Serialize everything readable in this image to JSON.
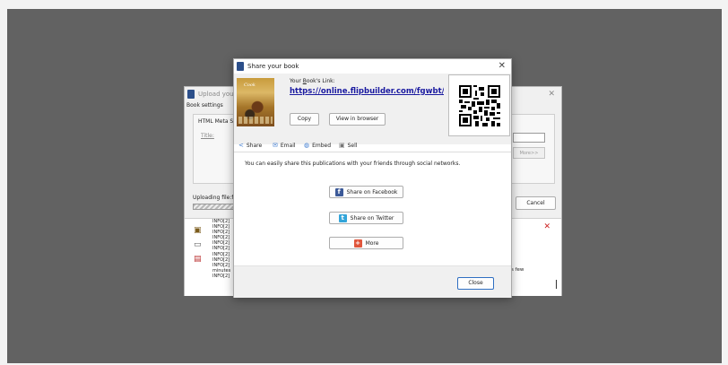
{
  "background_window": {
    "title": "Upload your",
    "tab_label": "Book settings",
    "group_legend": "HTML Meta Se",
    "title_field_label": "Title:",
    "more_label": "More>>",
    "uploading_label": "Uploading file:fli",
    "cancel_label": "Cancel",
    "log_lines": [
      "INFO[2]",
      "INFO[2]",
      "INFO[2]",
      "INFO[2]",
      "INFO[2]",
      "INFO[2]",
      "INFO[2]",
      "INFO[2]",
      "INFO[2]",
      "minutes",
      "INFO[2]"
    ],
    "log_tail": "s few"
  },
  "dialog": {
    "title": "Share your book",
    "link_label_prefix": "Your ",
    "link_label_underlined": "B",
    "link_label_suffix": "ook's Link:",
    "book_link": "https://online.flipbuilder.com/fgwbt/ceyu",
    "cover_title": "Cook",
    "copy_label": "Copy",
    "view_label": "View in browser",
    "tabs": {
      "share": "Share",
      "email": "Email",
      "embed": "Embed",
      "sell": "Sell"
    },
    "description": "You can easily share this publications with your friends through social networks.",
    "facebook_label": "Share on Facebook",
    "twitter_label": "Share on Twitter",
    "more_label": "More",
    "close_label": "Close"
  },
  "icons": {
    "facebook_glyph": "f",
    "twitter_glyph": "t",
    "more_glyph": "+"
  },
  "colors": {
    "facebook": "#3b5998",
    "twitter": "#33a5d9",
    "more": "#e0553b",
    "link": "#1a1aa0",
    "desktop": "#626262"
  }
}
